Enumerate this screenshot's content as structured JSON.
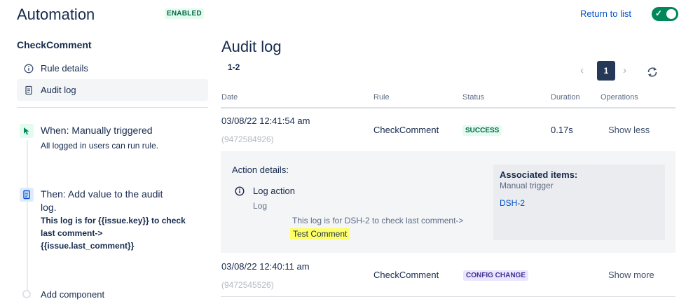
{
  "header": {
    "title": "Automation",
    "status_badge": "ENABLED",
    "return_link": "Return to list",
    "toggle_check": "✓"
  },
  "sidebar": {
    "rule_name": "CheckComment",
    "items": [
      {
        "label": "Rule details",
        "icon": "info-icon"
      },
      {
        "label": "Audit log",
        "icon": "document-icon",
        "active": true
      }
    ],
    "steps": [
      {
        "icon": "cursor-click-icon",
        "title": "When: Manually triggered",
        "subtitle": "All logged in users can run rule."
      },
      {
        "icon": "document-icon",
        "title_line1": "Then: Add value to the audit",
        "title_line2": "log.",
        "detail_line1": "This log is for {{issue.key}} to check",
        "detail_line2": "last comment->",
        "detail_line3": "{{issue.last_comment}}"
      }
    ],
    "add_component": "Add component"
  },
  "main": {
    "title": "Audit log",
    "range": "1-2",
    "pagination": {
      "prev": "‹",
      "current": "1",
      "next": "›"
    },
    "columns": [
      "Date",
      "Rule",
      "Status",
      "Duration",
      "Operations"
    ],
    "rows": [
      {
        "date": "03/08/22 12:41:54 am",
        "id": "(9472584926)",
        "rule": "CheckComment",
        "status": "SUCCESS",
        "duration": "0.17s",
        "operation": "Show less"
      },
      {
        "date": "03/08/22 12:40:11 am",
        "id": "(9472545526)",
        "rule": "CheckComment",
        "status": "CONFIG CHANGE",
        "duration": "",
        "operation": "Show more"
      }
    ],
    "details": {
      "title": "Action details:",
      "action": "Log action",
      "action_type": "Log",
      "message": "This log is for DSH-2 to check last comment->",
      "highlight": "Test Comment",
      "associated": {
        "title": "Associated items:",
        "trigger": "Manual trigger",
        "link": "DSH-2"
      }
    }
  },
  "colors": {
    "accent": "#0052cc",
    "success": "#00875a",
    "highlight": "#ffff66",
    "pagination_active": "#253858"
  }
}
